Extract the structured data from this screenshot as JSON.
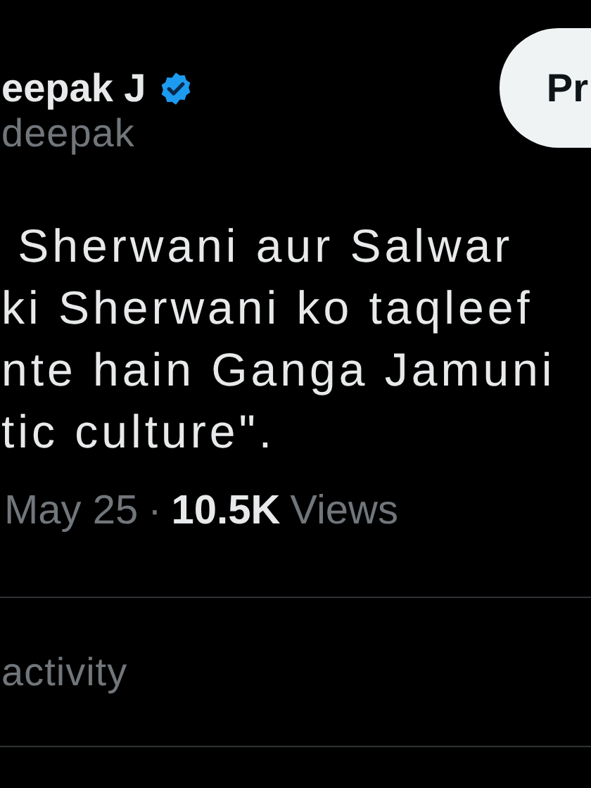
{
  "author": {
    "name": "eepak J",
    "verified": true,
    "handle": "deepak"
  },
  "action_button": {
    "label": "Pr"
  },
  "tweet_lines": [
    " Sherwani aur Salwar",
    "ki Sherwani ko taqleef",
    "nte hain Ganga Jamuni",
    "tic culture\"."
  ],
  "meta": {
    "date": "May 25",
    "separator": "·",
    "views_count": "10.5K",
    "views_label": "Views"
  },
  "activity_link": {
    "label": "activity"
  }
}
